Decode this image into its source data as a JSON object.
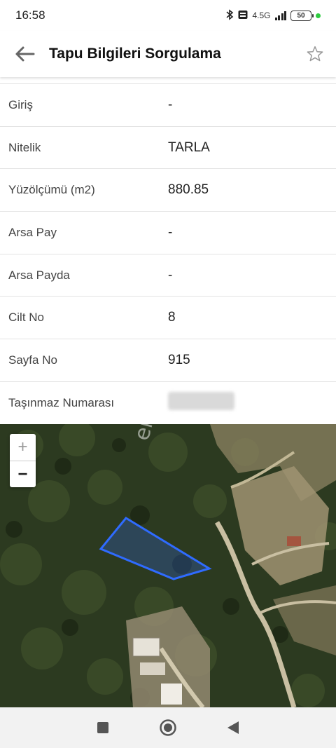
{
  "status_bar": {
    "time": "16:58",
    "network": "4.5G",
    "battery": "50"
  },
  "app_bar": {
    "title": "Tapu Bilgileri Sorgulama"
  },
  "info_rows": [
    {
      "label": "Giriş",
      "value": "-"
    },
    {
      "label": "Nitelik",
      "value": "TARLA"
    },
    {
      "label": "Yüzölçümü (m2)",
      "value": "880.85"
    },
    {
      "label": "Arsa Pay",
      "value": "-"
    },
    {
      "label": "Arsa Payda",
      "value": "-"
    },
    {
      "label": "Cilt No",
      "value": "8"
    },
    {
      "label": "Sayfa No",
      "value": "915"
    },
    {
      "label": "Taşınmaz Numarası",
      "value": ""
    }
  ],
  "map": {
    "zoom_in": "+",
    "zoom_out": "−",
    "watermark": "em",
    "parcel_color": "#2f6bff"
  }
}
